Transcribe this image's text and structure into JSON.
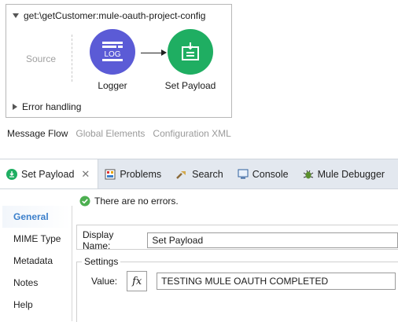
{
  "flow": {
    "title": "get:\\getCustomer:mule-oauth-project-config",
    "source_label": "Source",
    "nodes": [
      {
        "label": "Logger",
        "icon": "logger-icon",
        "color": "#5b5bd6"
      },
      {
        "label": "Set Payload",
        "icon": "set-payload-icon",
        "color": "#1fae62"
      }
    ],
    "logger_icon_text": "LOG",
    "error_handling": "Error handling"
  },
  "editor_tabs": [
    "Message Flow",
    "Global Elements",
    "Configuration XML"
  ],
  "panel_tabs": [
    {
      "label": "Set Payload",
      "icon": "set-payload-icon"
    },
    {
      "label": "Problems",
      "icon": "problems-icon"
    },
    {
      "label": "Search",
      "icon": "search-icon"
    },
    {
      "label": "Console",
      "icon": "console-icon"
    },
    {
      "label": "Mule Debugger",
      "icon": "debugger-icon"
    }
  ],
  "status": "There are no errors.",
  "side_nav": [
    "General",
    "MIME Type",
    "Metadata",
    "Notes",
    "Help"
  ],
  "form": {
    "display_name_label": "Display Name:",
    "display_name_value": "Set Payload",
    "settings_legend": "Settings",
    "value_label": "Value:",
    "fx_label": "fx",
    "value_value": "TESTING MULE OAUTH COMPLETED"
  },
  "colors": {
    "accent": "#3b7fcb",
    "logger": "#5b5bd6",
    "set_payload": "#1fae62",
    "ok": "#4caf50"
  }
}
